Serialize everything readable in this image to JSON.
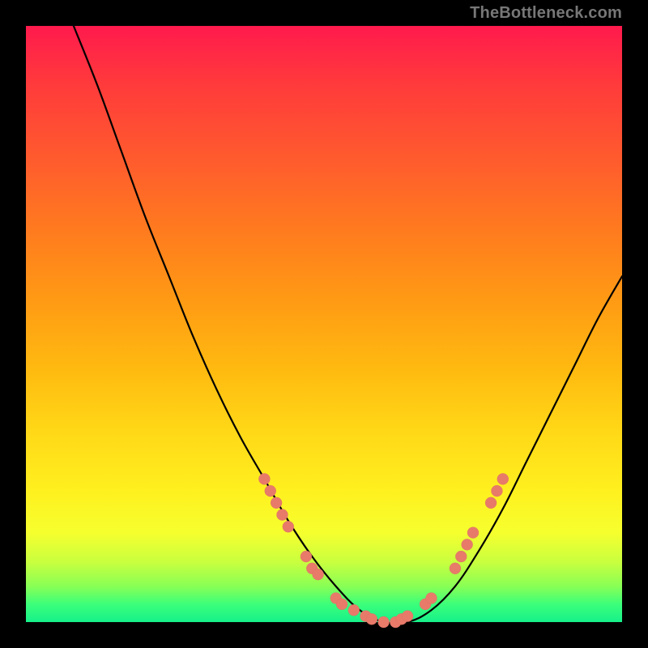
{
  "watermark": "TheBottleneck.com",
  "chart_data": {
    "type": "line",
    "title": "",
    "xlabel": "",
    "ylabel": "",
    "xlim": [
      0,
      100
    ],
    "ylim": [
      0,
      100
    ],
    "gradient_bands": [
      {
        "stop": 0,
        "color": "#ff1a4d"
      },
      {
        "stop": 10,
        "color": "#ff3b3b"
      },
      {
        "stop": 22,
        "color": "#ff5a2e"
      },
      {
        "stop": 34,
        "color": "#ff7a1f"
      },
      {
        "stop": 46,
        "color": "#ff9a14"
      },
      {
        "stop": 58,
        "color": "#ffbb10"
      },
      {
        "stop": 68,
        "color": "#ffd817"
      },
      {
        "stop": 78,
        "color": "#fff01f"
      },
      {
        "stop": 85,
        "color": "#f6ff2e"
      },
      {
        "stop": 90,
        "color": "#c8ff3f"
      },
      {
        "stop": 94,
        "color": "#88ff55"
      },
      {
        "stop": 97,
        "color": "#3cff7a"
      },
      {
        "stop": 100,
        "color": "#16f08a"
      }
    ],
    "series": [
      {
        "name": "bottleneck-curve",
        "x": [
          8,
          12,
          16,
          20,
          24,
          28,
          32,
          36,
          40,
          44,
          48,
          52,
          56,
          60,
          64,
          68,
          72,
          76,
          80,
          84,
          88,
          92,
          96,
          100
        ],
        "y": [
          100,
          90,
          79,
          68,
          58,
          48,
          39,
          31,
          24,
          17,
          11,
          6,
          2,
          0,
          0,
          2,
          6,
          12,
          19,
          27,
          35,
          43,
          51,
          58
        ]
      }
    ],
    "highlight_points": {
      "name": "salmon-dots",
      "color": "#e87a6a",
      "points": [
        {
          "x": 40,
          "y": 24
        },
        {
          "x": 41,
          "y": 22
        },
        {
          "x": 42,
          "y": 20
        },
        {
          "x": 43,
          "y": 18
        },
        {
          "x": 44,
          "y": 16
        },
        {
          "x": 47,
          "y": 11
        },
        {
          "x": 48,
          "y": 9
        },
        {
          "x": 49,
          "y": 8
        },
        {
          "x": 52,
          "y": 4
        },
        {
          "x": 53,
          "y": 3
        },
        {
          "x": 55,
          "y": 2
        },
        {
          "x": 57,
          "y": 1
        },
        {
          "x": 58,
          "y": 0.5
        },
        {
          "x": 60,
          "y": 0
        },
        {
          "x": 62,
          "y": 0
        },
        {
          "x": 63,
          "y": 0.5
        },
        {
          "x": 64,
          "y": 1
        },
        {
          "x": 67,
          "y": 3
        },
        {
          "x": 68,
          "y": 4
        },
        {
          "x": 72,
          "y": 9
        },
        {
          "x": 73,
          "y": 11
        },
        {
          "x": 74,
          "y": 13
        },
        {
          "x": 75,
          "y": 15
        },
        {
          "x": 78,
          "y": 20
        },
        {
          "x": 79,
          "y": 22
        },
        {
          "x": 80,
          "y": 24
        }
      ]
    }
  }
}
